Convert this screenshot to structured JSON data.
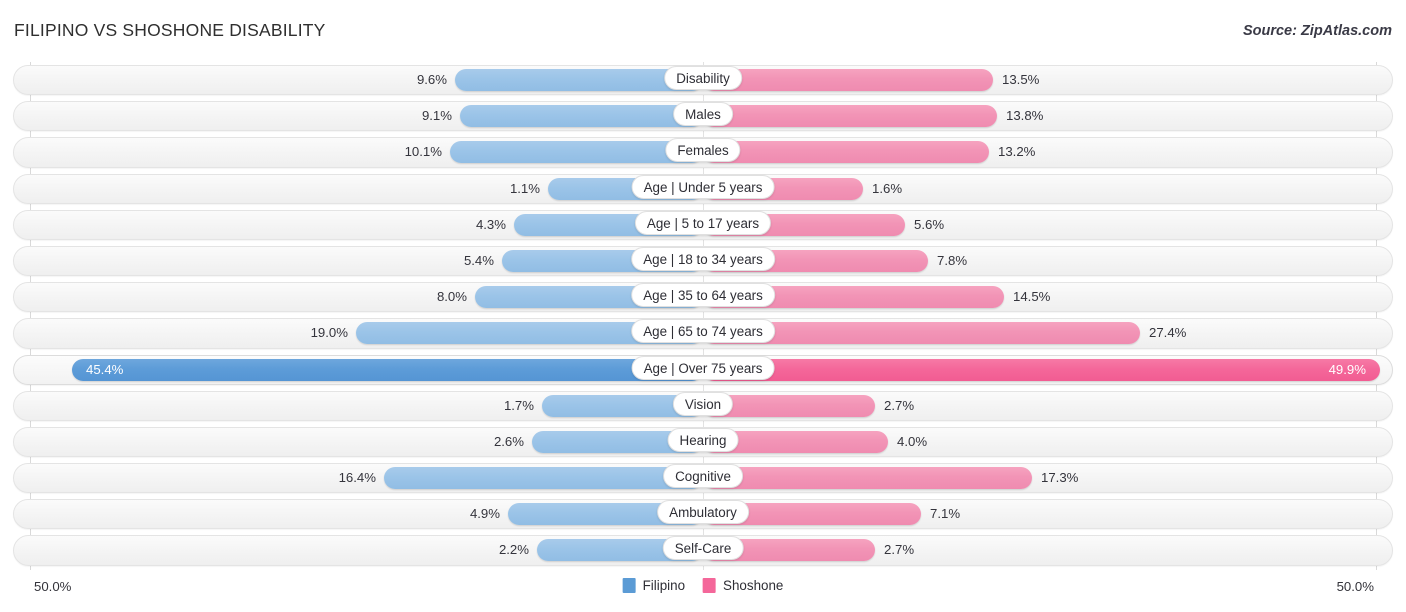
{
  "header": {
    "title": "FILIPINO VS SHOSHONE DISABILITY",
    "source": "Source: ZipAtlas.com"
  },
  "axis": {
    "left_label": "50.0%",
    "right_label": "50.0%",
    "max": 50.0
  },
  "legend": [
    {
      "name": "legend-filipino",
      "label": "Filipino",
      "color": "#5b9bd5"
    },
    {
      "name": "legend-shoshone",
      "label": "Shoshone",
      "color": "#f4679a"
    }
  ],
  "colors": {
    "filipino_light": "#9bc4e8",
    "filipino_dark": "#5d9cd8",
    "shoshone_light": "#f294b6",
    "shoshone_dark": "#f4679a",
    "track": "#f4f4f4",
    "gridline": "#d9d9d9"
  },
  "chart_data": {
    "type": "bar",
    "subtype": "diverging-bidirectional",
    "title": "FILIPINO VS SHOSHONE DISABILITY",
    "xlabel": "",
    "ylabel": "",
    "xlim": [
      50.0,
      50.0
    ],
    "grid": true,
    "legend_position": "bottom-center",
    "categories": [
      "Disability",
      "Males",
      "Females",
      "Age | Under 5 years",
      "Age | 5 to 17 years",
      "Age | 18 to 34 years",
      "Age | 35 to 64 years",
      "Age | 65 to 74 years",
      "Age | Over 75 years",
      "Vision",
      "Hearing",
      "Cognitive",
      "Ambulatory",
      "Self-Care"
    ],
    "series": [
      {
        "name": "Filipino",
        "color": "#9bc4e8",
        "values": [
          9.6,
          9.1,
          10.1,
          1.1,
          4.3,
          5.4,
          8.0,
          19.0,
          45.4,
          1.7,
          2.6,
          16.4,
          4.9,
          2.2
        ],
        "labels": [
          "9.6%",
          "9.1%",
          "10.1%",
          "1.1%",
          "4.3%",
          "5.4%",
          "8.0%",
          "19.0%",
          "45.4%",
          "1.7%",
          "2.6%",
          "16.4%",
          "4.9%",
          "2.2%"
        ]
      },
      {
        "name": "Shoshone",
        "color": "#f294b6",
        "values": [
          13.5,
          13.8,
          13.2,
          1.6,
          5.6,
          7.8,
          14.5,
          27.4,
          49.9,
          2.7,
          4.0,
          17.3,
          7.1,
          2.7
        ],
        "labels": [
          "13.5%",
          "13.8%",
          "13.2%",
          "1.6%",
          "5.6%",
          "7.8%",
          "14.5%",
          "27.4%",
          "49.9%",
          "2.7%",
          "4.0%",
          "17.3%",
          "7.1%",
          "2.7%"
        ]
      }
    ],
    "highlighted_row": "Age | Over 75 years"
  },
  "rows": [
    {
      "label": "Disability",
      "left_value": "9.6%",
      "right_value": "13.5%",
      "left_w": 248,
      "right_w": 290,
      "highlight": false
    },
    {
      "label": "Males",
      "left_value": "9.1%",
      "right_value": "13.8%",
      "left_w": 243,
      "right_w": 294,
      "highlight": false
    },
    {
      "label": "Females",
      "left_value": "10.1%",
      "right_value": "13.2%",
      "left_w": 253,
      "right_w": 286,
      "highlight": false
    },
    {
      "label": "Age | Under 5 years",
      "left_value": "1.1%",
      "right_value": "1.6%",
      "left_w": 155,
      "right_w": 160,
      "highlight": false
    },
    {
      "label": "Age | 5 to 17 years",
      "left_value": "4.3%",
      "right_value": "5.6%",
      "left_w": 189,
      "right_w": 202,
      "highlight": false
    },
    {
      "label": "Age | 18 to 34 years",
      "left_value": "5.4%",
      "right_value": "7.8%",
      "left_w": 201,
      "right_w": 225,
      "highlight": false
    },
    {
      "label": "Age | 35 to 64 years",
      "left_value": "8.0%",
      "right_value": "14.5%",
      "left_w": 228,
      "right_w": 301,
      "highlight": false
    },
    {
      "label": "Age | 65 to 74 years",
      "left_value": "19.0%",
      "right_value": "27.4%",
      "left_w": 347,
      "right_w": 437,
      "highlight": false
    },
    {
      "label": "Age | Over 75 years",
      "left_value": "45.4%",
      "right_value": "49.9%",
      "left_w": 631,
      "right_w": 677,
      "highlight": true
    },
    {
      "label": "Vision",
      "left_value": "1.7%",
      "right_value": "2.7%",
      "left_w": 161,
      "right_w": 172,
      "highlight": false
    },
    {
      "label": "Hearing",
      "left_value": "2.6%",
      "right_value": "4.0%",
      "left_w": 171,
      "right_w": 185,
      "highlight": false
    },
    {
      "label": "Cognitive",
      "left_value": "16.4%",
      "right_value": "17.3%",
      "left_w": 319,
      "right_w": 329,
      "highlight": false
    },
    {
      "label": "Ambulatory",
      "left_value": "4.9%",
      "right_value": "7.1%",
      "left_w": 195,
      "right_w": 218,
      "highlight": false
    },
    {
      "label": "Self-Care",
      "left_value": "2.2%",
      "right_value": "2.7%",
      "left_w": 166,
      "right_w": 172,
      "highlight": false
    }
  ]
}
